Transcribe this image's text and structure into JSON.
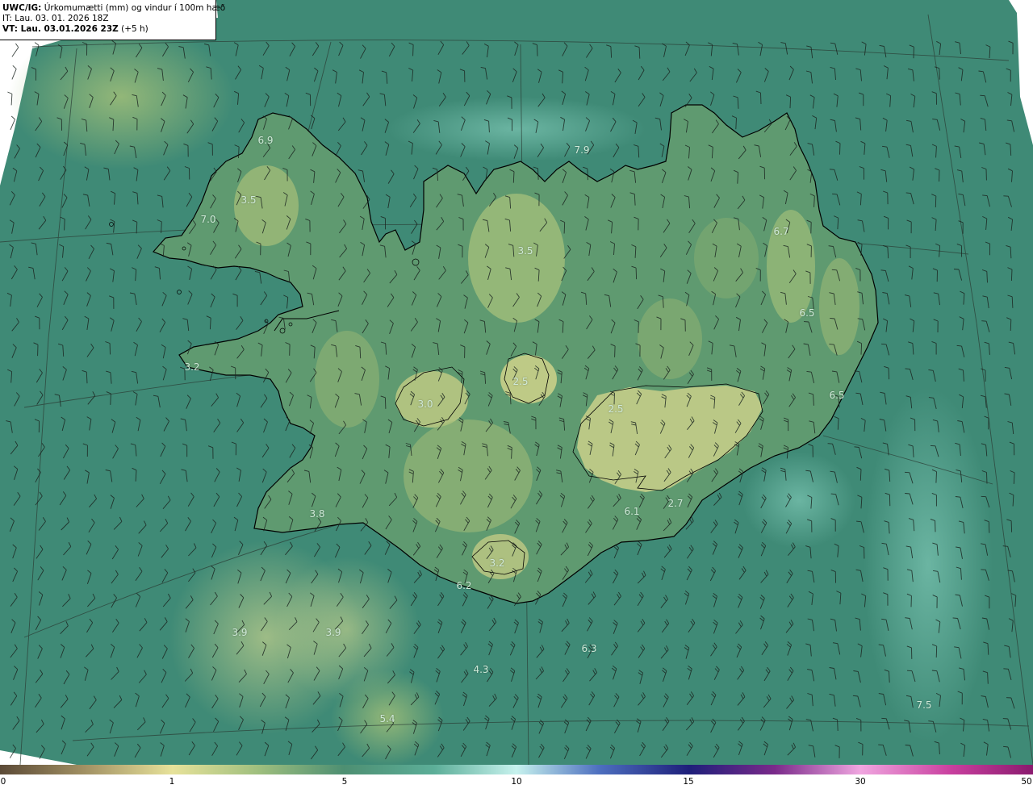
{
  "header": {
    "title_prefix": "UWC/IG:",
    "title_text": " Úrkomumætti (mm) og vindur í 100m hæð",
    "initial_time": "IT: Lau. 03. 01. 2026 18Z",
    "valid_prefix": "VT: Lau. 03.01.2026 23Z",
    "valid_suffix": " (+5 h)"
  },
  "map_values": [
    "6.9",
    "3.5",
    "7.0",
    "7.9",
    "3.5",
    "6.7",
    "6.5",
    "3.2",
    "2.5",
    "3.0",
    "2.5",
    "6.5",
    "6.1",
    "2.7",
    "3.8",
    "3.2",
    "6.2",
    "3.9",
    "3.9",
    "6.3",
    "4.3",
    "5.4",
    "7.5"
  ],
  "colorbar": {
    "ticks": [
      "0",
      "1",
      "5",
      "10",
      "15",
      "30",
      "50"
    ]
  },
  "colors": {
    "ocean": "#3f8a76",
    "land_low": "#5f9a70",
    "land_high": "#c9d08a",
    "coastline": "#000000"
  }
}
